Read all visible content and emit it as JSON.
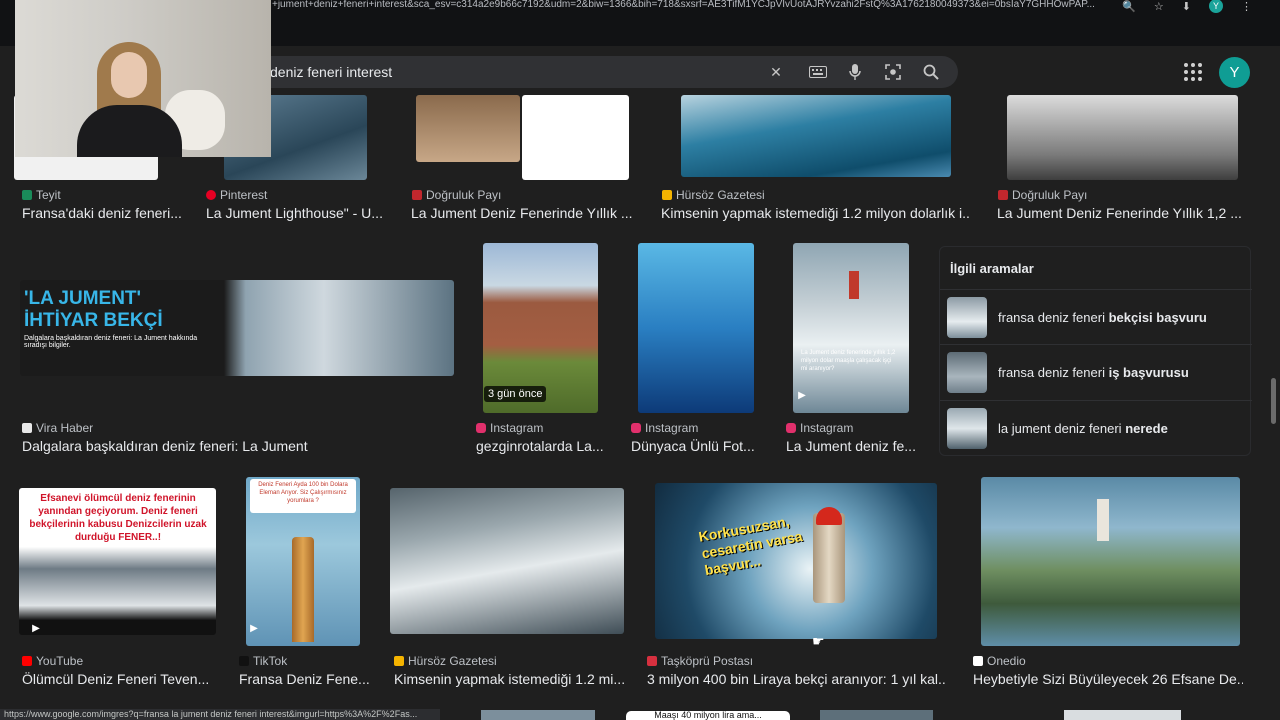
{
  "browser": {
    "url": "+jument+deniz+feneri+interest&sca_esv=c314a2e9b66c7192&udm=2&biw=1366&bih=718&sxsrf=AE3TifM1YCJpVIvUotAJRYvzahi2FstQ%3A1762180049373&ei=0bsIaY7GHHOwPAP...",
    "profile_letter": "Y"
  },
  "search": {
    "query": "deniz feneri interest"
  },
  "header": {
    "avatar_letter": "Y"
  },
  "results": [
    {
      "source": "Teyit",
      "caption": "Fransa'daki deniz feneri..."
    },
    {
      "source": "Pinterest",
      "caption": "La Jument Lighthouse\" - U..."
    },
    {
      "source": "Doğruluk Payı",
      "caption": "La Jument Deniz Fenerinde Yıllık ..."
    },
    {
      "source": "Hürsöz Gazetesi",
      "caption": "Kimsenin yapmak istemediği 1.2 milyon dolarlık i..."
    },
    {
      "source": "Doğruluk Payı",
      "caption": "La Jument Deniz Fenerinde Yıllık 1,2 ..."
    },
    {
      "source": "Vira Haber",
      "caption": "Dalgalara başkaldıran deniz feneri: La Jument",
      "thumb_title_1": "'LA JUMENT'",
      "thumb_title_2": "İHTİYAR BEKÇİ",
      "thumb_sub": "Dalgalara başkaldıran deniz feneri: La Jument hakkında sıradışı bilgiler."
    },
    {
      "source": "Instagram",
      "caption": "gezginrotalarda La...",
      "badge": "3 gün önce"
    },
    {
      "source": "Instagram",
      "caption": "Dünyaca Ünlü Fot..."
    },
    {
      "source": "Instagram",
      "caption": "La Jument deniz fe...",
      "thumb_text": "La Jument deniz fenerinde yıllık 1,2 milyon dolar maaşla çalışacak işçi mi aranıyor?"
    },
    {
      "source": "YouTube",
      "caption": "Ölümcül Deniz Feneri Teven...",
      "thumb_text": "Efsanevi ölümcül deniz fenerinin yanından geçiyorum. Deniz feneri bekçilerinin kabusu Denizcilerin uzak durduğu FENER..!"
    },
    {
      "source": "TikTok",
      "caption": "Fransa Deniz Fene...",
      "thumb_text": "Deniz Feneri Ayda 100 bin Dolara Eleman Arıyor. Siz Çalışırmısınız yorumlara ?"
    },
    {
      "source": "Hürsöz Gazetesi",
      "caption": "Kimsenin yapmak istemediği 1.2 mi..."
    },
    {
      "source": "Taşköprü Postası",
      "caption": "3 milyon 400 bin Liraya bekçi aranıyor: 1 yıl kal...",
      "thumb_text": "Korkusuzsan, cesaretin varsa başvur..."
    },
    {
      "source": "Onedio",
      "caption": "Heybetiyle Sizi Büyüleyecek 26 Efsane De..."
    }
  ],
  "related": {
    "title": "İlgili aramalar",
    "items": [
      {
        "prefix": "fransa deniz feneri ",
        "bold": "bekçisi başvuru"
      },
      {
        "prefix": "fransa deniz feneri ",
        "bold": "iş başvurusu"
      },
      {
        "prefix": "la jument deniz feneri ",
        "bold": "nerede"
      }
    ]
  },
  "status_url": "https://www.google.com/imgres?q=fransa la jument deniz feneri interest&imgurl=https%3A%2F%2Fas...",
  "bottom_badge": "Maaşı 40 milyon lira ama..."
}
